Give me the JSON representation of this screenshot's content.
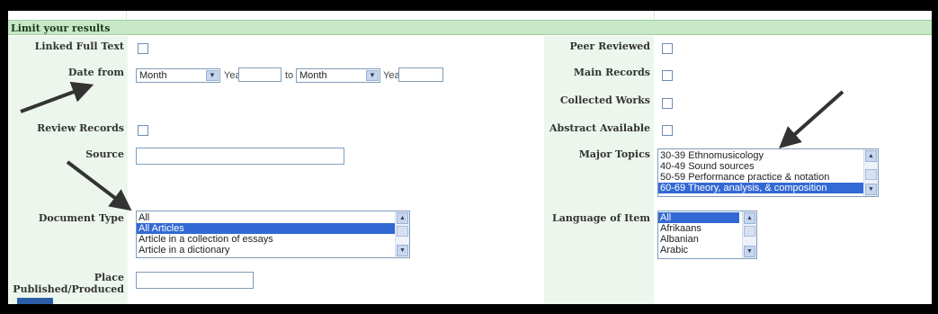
{
  "header": {
    "title": "Limit your results"
  },
  "left": {
    "linked_full_text": {
      "label": "Linked Full Text"
    },
    "date_from": {
      "label": "Date from",
      "month_from": "Month",
      "year_label_1": "Year:",
      "to_text": "to",
      "month_to": "Month",
      "year_label_2": "Year:"
    },
    "review_records": {
      "label": "Review Records"
    },
    "source": {
      "label": "Source"
    },
    "document_type": {
      "label": "Document Type",
      "options": [
        "All",
        "All Articles",
        "Article in a collection of essays",
        "Article in a dictionary"
      ],
      "selected_index": 1
    },
    "place_published": {
      "label_line1": "Place",
      "label_line2": "Published/Produced"
    }
  },
  "right": {
    "peer_reviewed": {
      "label": "Peer Reviewed"
    },
    "main_records": {
      "label": "Main Records"
    },
    "collected_works": {
      "label": "Collected Works"
    },
    "abstract_available": {
      "label": "Abstract Available"
    },
    "major_topics": {
      "label": "Major Topics",
      "options": [
        "30-39 Ethnomusicology",
        "40-49 Sound sources",
        "50-59 Performance practice & notation",
        "60-69 Theory, analysis, & composition"
      ],
      "selected_index": 3
    },
    "language": {
      "label": "Language of Item",
      "options": [
        "All",
        "Afrikaans",
        "Albanian",
        "Arabic"
      ],
      "selected_index": 0
    }
  },
  "colors": {
    "header_bg": "#c6e8c6",
    "label_col_bg": "#edf6ed",
    "selection": "#3369d5",
    "frame": "#000000"
  }
}
